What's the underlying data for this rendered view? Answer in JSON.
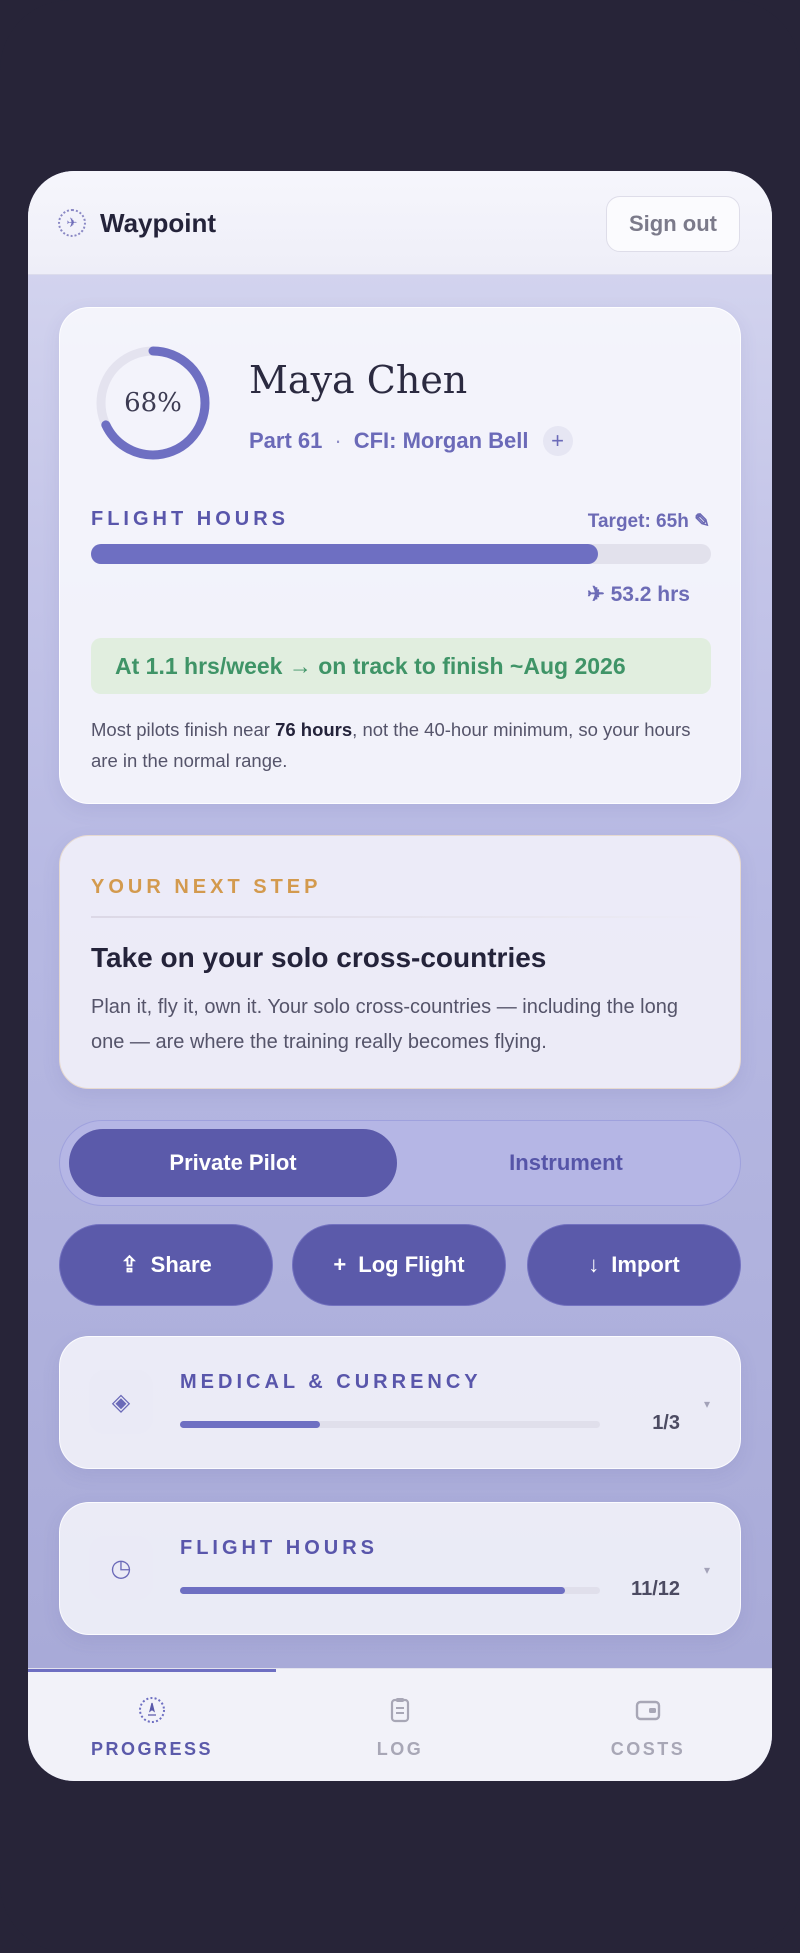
{
  "app": {
    "name": "Waypoint",
    "sign_out": "Sign out"
  },
  "profile": {
    "progress_label": "68%",
    "progress_value": 0.68,
    "name": "Maya Chen",
    "part": "Part 61",
    "separator": "·",
    "cfi": "CFI: Morgan Bell",
    "add_label": "+"
  },
  "flight_hours": {
    "label": "FLIGHT HOURS",
    "target": "Target: 65h ✎",
    "progress_value": 0.818,
    "hours": "✈ 53.2 hrs",
    "banner": "At 1.1 hrs/week → on track to finish ~Aug 2026",
    "note_pre": "Most pilots finish near ",
    "note_bold": "76 hours",
    "note_post": ", not the 40-hour minimum, so your hours are in the normal range."
  },
  "next_step": {
    "label": "YOUR NEXT STEP",
    "title": "Take on your solo cross-countries",
    "body": "Plan it, fly it, own it. Your solo cross-countries — including the long one — are where the training really becomes flying."
  },
  "tracks": {
    "active": "Private Pilot",
    "inactive": "Instrument"
  },
  "actions": {
    "share": {
      "icon": "⇪",
      "label": "Share"
    },
    "log": {
      "icon": "+",
      "label": "Log Flight"
    },
    "import": {
      "icon": "↓",
      "label": "Import"
    }
  },
  "sections": [
    {
      "title": "MEDICAL & CURRENCY",
      "icon": "◈",
      "count": "1/3",
      "progress": 0.333
    },
    {
      "title": "FLIGHT HOURS",
      "icon": "◷",
      "count": "11/12",
      "progress": 0.917
    }
  ],
  "nav": {
    "progress": "PROGRESS",
    "log": "LOG",
    "costs": "COSTS"
  },
  "colors": {
    "accent": "#5b5aaa",
    "accent_light": "#6e6fc2",
    "success": "#3f9467",
    "next_step": "#d39a4e",
    "nav_inactive": "#a8a7b6"
  }
}
